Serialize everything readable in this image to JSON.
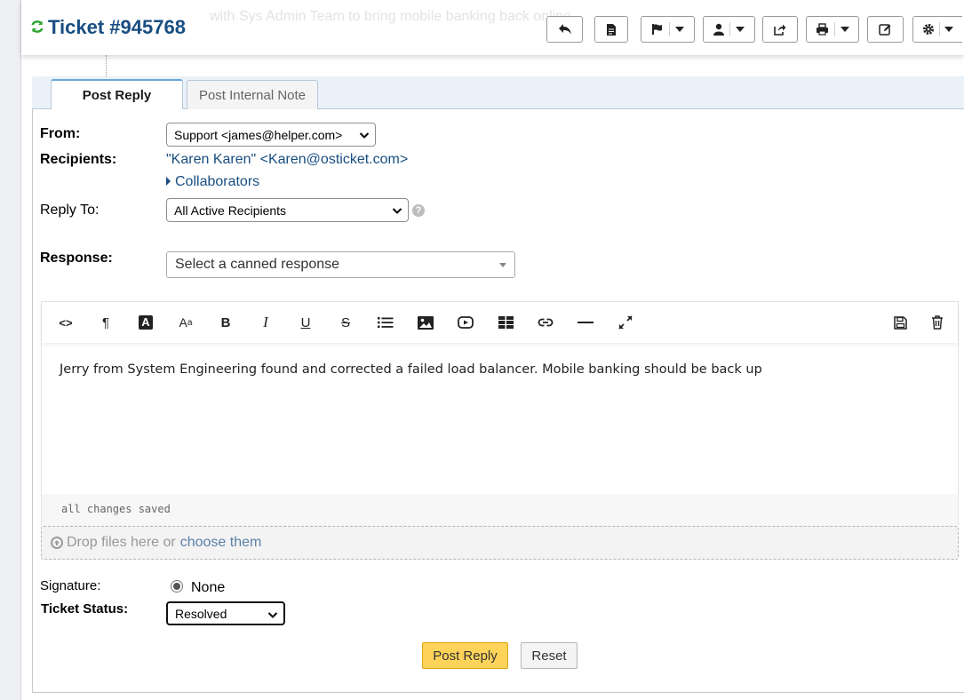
{
  "header": {
    "ticket_title": "Ticket #945768",
    "ghost_text": "with Sys Admin Team to bring mobile banking back online"
  },
  "toolbar": {
    "buttons": [
      "reply-icon",
      "file-icon",
      "flag-icon",
      "user-icon",
      "share-icon",
      "print-icon",
      "edit-icon",
      "gear-icon"
    ]
  },
  "tabs": {
    "post_reply": "Post Reply",
    "post_internal_note": "Post Internal Note"
  },
  "form": {
    "from_label": "From:",
    "from_value": "Support <james@helper.com>",
    "recipients_label": "Recipients:",
    "recipients_value": "\"Karen Karen\" <Karen@osticket.com>",
    "collaborators": "Collaborators",
    "reply_to_label": "Reply To:",
    "reply_to_value": "All Active Recipients",
    "response_label": "Response:",
    "canned_placeholder": "Select a canned response"
  },
  "editor": {
    "body_text": "Jerry from System Engineering found and corrected a failed load balancer. Mobile banking should be back up",
    "status": "all changes saved",
    "tools": [
      "code-icon",
      "paragraph-icon",
      "text-color-icon",
      "font-size-icon",
      "bold-icon",
      "italic-icon",
      "underline-icon",
      "strikethrough-icon",
      "list-icon",
      "image-icon",
      "video-icon",
      "table-icon",
      "link-icon",
      "horizontal-rule-icon",
      "fullscreen-icon",
      "save-draft-icon",
      "trash-icon"
    ]
  },
  "dropzone": {
    "text": "Drop files here or",
    "link": "choose them"
  },
  "signature": {
    "label": "Signature:",
    "option": "None"
  },
  "status": {
    "label": "Ticket Status:",
    "value": "Resolved"
  },
  "actions": {
    "post_reply": "Post Reply",
    "reset": "Reset"
  },
  "colors": {
    "title": "#184e81",
    "refresh": "#2ea32e",
    "primary_button": "#fdd35a",
    "link": "#184e81"
  }
}
